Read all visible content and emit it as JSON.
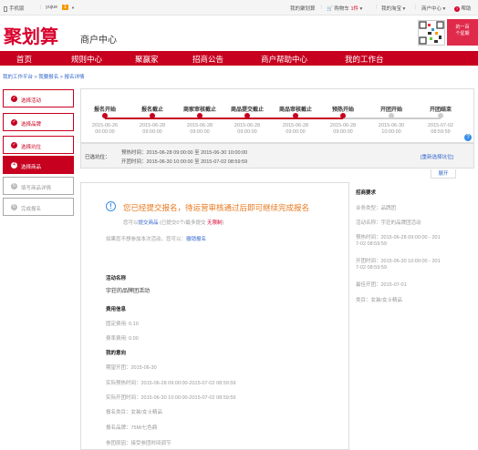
{
  "topbar": {
    "mobile": "手机版",
    "user": "yujue",
    "badge": "1",
    "my_jhs": "我的聚划算",
    "cart": "购物车",
    "cart_count": "1件",
    "my_taobao": "我的淘宝",
    "merchant_center": "商户中心",
    "help": "帮助"
  },
  "header": {
    "logo": "聚划算",
    "subtitle": "商户中心",
    "banner_line1": "的一百",
    "banner_line2": "个星期"
  },
  "nav": [
    "首页",
    "规则中心",
    "聚赢家",
    "招商公告",
    "商户帮助中心",
    "我的工作台"
  ],
  "breadcrumb": "我的工作平台  >  我要报名  >  报名详情",
  "sidebar": [
    {
      "label": "选择活动",
      "mark": "✓",
      "state": "done"
    },
    {
      "label": "选择品牌",
      "mark": "✓",
      "state": "done"
    },
    {
      "label": "选择坑位",
      "mark": "✓",
      "state": "done"
    },
    {
      "label": "选择商品",
      "mark": "4",
      "state": "active"
    },
    {
      "label": "填写商品详情",
      "mark": "5",
      "state": "disabled"
    },
    {
      "label": "完成报名",
      "mark": "6",
      "state": "disabled"
    }
  ],
  "timeline": [
    {
      "title": "报名开始",
      "date": "2015-06-26",
      "time": "00:00:00",
      "status": "done"
    },
    {
      "title": "报名截止",
      "date": "2015-06-28",
      "time": "09:00:00",
      "status": "done"
    },
    {
      "title": "商家审核截止",
      "date": "2015-06-28",
      "time": "09:00:00",
      "status": "done"
    },
    {
      "title": "商品提交截止",
      "date": "2015-06-28",
      "time": "09:00:00",
      "status": "done"
    },
    {
      "title": "商品审核截止",
      "date": "2015-06-28",
      "time": "09:00:00",
      "status": "done"
    },
    {
      "title": "预热开始",
      "date": "2015-06-28",
      "time": "09:00:00",
      "status": "done"
    },
    {
      "title": "开团开始",
      "date": "2015-06-30",
      "time": "10:00:00",
      "status": "pending"
    },
    {
      "title": "开团结束",
      "date": "2015-07-02",
      "time": "08:59:59",
      "status": "pending"
    }
  ],
  "help_icon": "?",
  "slot": {
    "label": "已选坑位：",
    "preheat": "预热时间：2015-06-28 09:00:00 至 2015-06-30 10:00:00",
    "open": "开团时间：2015-06-30 10:00:00 至 2015-07-02 08:59:59",
    "reselect": "[重新选择坑位]",
    "expand": "展开"
  },
  "main": {
    "notice": "您已经提交报名，待运营审核通过后即可继续完成报名",
    "line1_prefix": "您可以",
    "line1_link": "提交商品",
    "line1_mid": " (已提交0个/最多提交 ",
    "line1_limit": "无限制",
    "line1_suffix": ")",
    "line2_prefix": "如果您不想参加本次活动，您可以：",
    "line2_link": "撤销报名",
    "activity_name_label": "活动名称",
    "activity_name": "宇荘的品牌团活动",
    "fee_label": "费用信息",
    "fixed_fee": "固定费用: 0.10",
    "rate_fee": "费率费用: 0.00",
    "my_intent_label": "我的意向",
    "expect_open": "期望开团：2015-06-30",
    "actual_preheat": "实际预热时间：2015-06-28 09:00:00-2015-07-02 08:59:59",
    "actual_open": "实际开团时间：2015-06-30 10:00:00-2015-07-02 08:59:59",
    "category": "报名类目：女装/女士精品",
    "brand": "报名品牌：75M/七色鼎",
    "reason": "参团原因：接受参团时间调节"
  },
  "requirements": {
    "title": "招商要求",
    "type": "业务类型：品牌团",
    "activity": "活动名称：宇荘的品牌团活动",
    "preheat_label": "预热时间：2015-06-28 09:00:00 - 201",
    "preheat_cont": "7-02 08:59:59",
    "open_label": "开团时间：2015-06-30 10:00:00 - 201",
    "open_cont": "7-02 08:59:59",
    "bestopen": "最佳开团：2015-07-01",
    "category": "类目：女装/女士精品"
  },
  "colors": {
    "brand_red": "#c7001f",
    "link_blue": "#3366cc",
    "done_dot": "#c7001f",
    "pending_dot": "#cccccc"
  }
}
